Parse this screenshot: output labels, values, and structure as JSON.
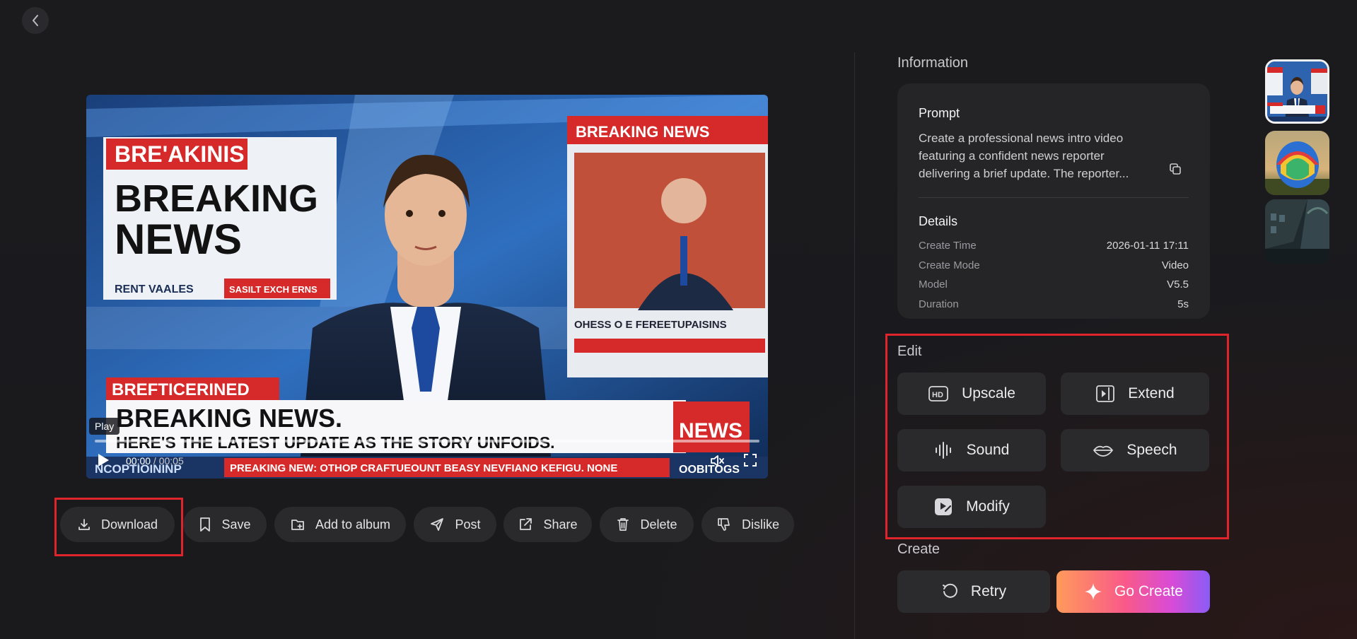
{
  "video": {
    "play_label": "Play",
    "current_time": "00:00",
    "separator": " / ",
    "total_time": "00:05",
    "frame_text": {
      "top_left_tag": "BRE'AKINIS",
      "headline_line1": "BREAKING",
      "headline_line2": "NEWS",
      "left_subtag1": "RENT VAALES",
      "left_subtag2": "SASILT EXCH ERNS",
      "monitor_tag": "BREAKING NEWS",
      "monitor_caption": "OHESS O E FEREETUPAISINS",
      "lower_tag": "BREFTICERINED",
      "lower_headline": "BREAKING NEWS.",
      "lower_sub": "HERE'S THE LATEST UPDATE AS THE STORY UNFOIDS.",
      "news_box": "NEWS",
      "ticker_left": "NCOPTIOININP",
      "ticker_main": "PREAKING NEW: OTHOP CRAFTUEOUNT BEASY NEVFIANO KEFIGU. NONE",
      "ticker_right": "OOBITOGS"
    }
  },
  "actions": [
    {
      "label": "Download",
      "icon": "download-icon"
    },
    {
      "label": "Save",
      "icon": "bookmark-icon"
    },
    {
      "label": "Add to album",
      "icon": "add-to-album-icon"
    },
    {
      "label": "Post",
      "icon": "send-icon"
    },
    {
      "label": "Share",
      "icon": "share-icon"
    },
    {
      "label": "Delete",
      "icon": "trash-icon"
    },
    {
      "label": "Dislike",
      "icon": "thumbs-down-icon"
    }
  ],
  "info": {
    "section_title": "Information",
    "prompt_title": "Prompt",
    "prompt_line1": "Create a professional news intro video",
    "prompt_line2": "featuring a confident news reporter",
    "prompt_line3": "delivering a brief update. The reporter...",
    "details_title": "Details",
    "details": [
      {
        "label": "Create Time",
        "value": "2026-01-11 17:11"
      },
      {
        "label": "Create Mode",
        "value": "Video"
      },
      {
        "label": "Model",
        "value": "V5.5"
      },
      {
        "label": "Duration",
        "value": "5s"
      }
    ]
  },
  "edit": {
    "section_title": "Edit",
    "buttons": [
      {
        "label": "Upscale",
        "icon": "hd-icon"
      },
      {
        "label": "Extend",
        "icon": "extend-icon"
      },
      {
        "label": "Sound",
        "icon": "sound-wave-icon"
      },
      {
        "label": "Speech",
        "icon": "lips-icon"
      },
      {
        "label": "Modify",
        "icon": "modify-icon"
      }
    ]
  },
  "create": {
    "section_title": "Create",
    "retry_label": "Retry",
    "go_label": "Go Create"
  },
  "colors": {
    "background": "#1a1a1d",
    "card": "#252528",
    "button": "#2a2a2d",
    "highlight": "#e0242b",
    "gradient_start": "#ff9a5a",
    "gradient_end": "#8b5cf6"
  }
}
